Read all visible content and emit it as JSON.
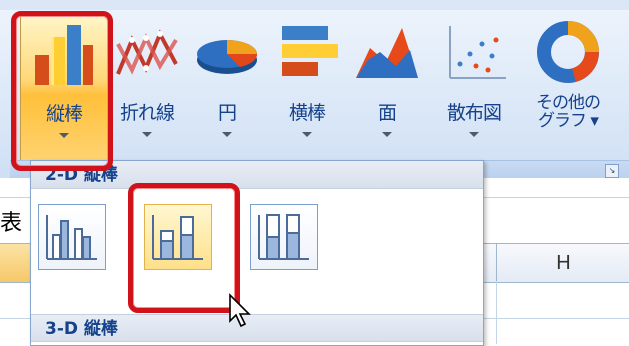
{
  "ribbon": {
    "chart_buttons": [
      {
        "label": "縦棒",
        "icon": "column-chart-icon",
        "active": true
      },
      {
        "label": "折れ線",
        "icon": "line-chart-icon"
      },
      {
        "label": "円",
        "icon": "pie-chart-icon"
      },
      {
        "label": "横棒",
        "icon": "bar-chart-icon"
      },
      {
        "label": "面",
        "icon": "area-chart-icon"
      },
      {
        "label": "散布図",
        "icon": "scatter-chart-icon"
      },
      {
        "label_line1": "その他の",
        "label_line2": "グラフ",
        "icon": "other-charts-icon"
      }
    ],
    "launcher_icon": "dialog-launcher-icon"
  },
  "gallery": {
    "section_2d": "2-D 縦棒",
    "section_3d": "3-D 縦棒",
    "items": [
      {
        "name": "clustered-column",
        "icon": "clustered-column-icon"
      },
      {
        "name": "stacked-column",
        "icon": "stacked-column-icon",
        "hovered": true
      },
      {
        "name": "100-percent-stacked-column",
        "icon": "percent-stacked-column-icon"
      }
    ]
  },
  "sheet": {
    "cell_fragment": "表",
    "column_header_h": "H"
  },
  "colors": {
    "highlight_red": "#d0121a",
    "ribbon_text": "#15428b",
    "active_orange": "#ffc03a"
  }
}
